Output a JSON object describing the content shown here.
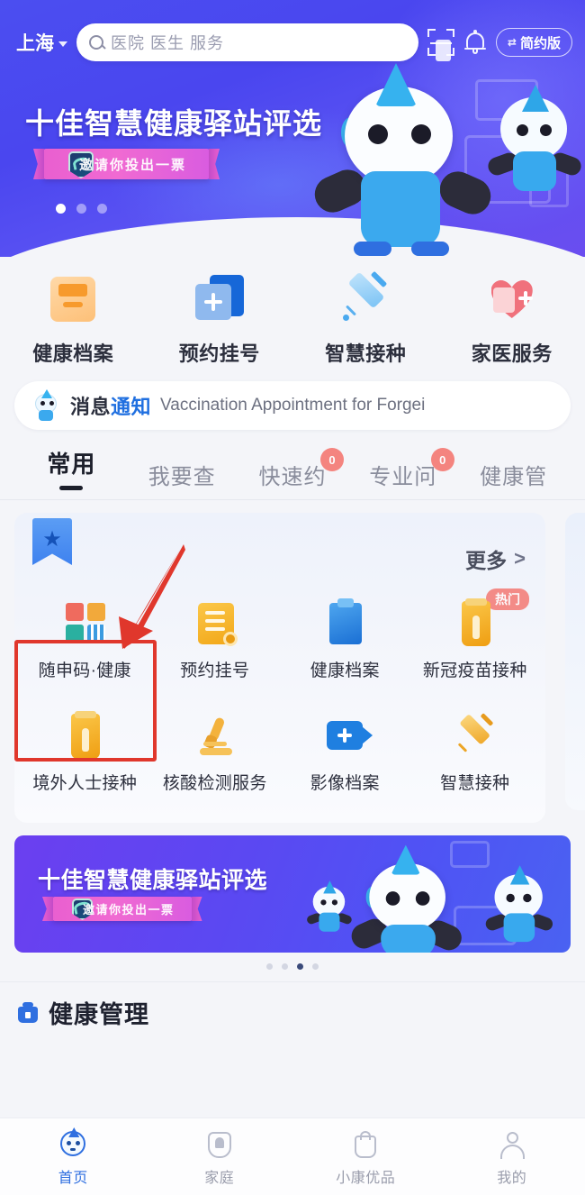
{
  "header": {
    "city": "上海",
    "city_chevron_icon": "chevron-down-icon",
    "search_placeholder": "医院 医生 服务",
    "search_icon": "search-icon",
    "scan_icon": "scan-code-icon",
    "bell_icon": "bell-icon",
    "simple_mode_label": "简约版",
    "simple_mode_icon": "toggle-icon"
  },
  "hero_banner": {
    "title": "十佳智慧健康驿站评选",
    "ribbon_text": "邀请你投出一票",
    "seal_icon": "shield-handshake-icon",
    "dots_total": 3,
    "dots_active": 1
  },
  "quick_actions": [
    {
      "label": "健康档案",
      "icon": "health-record-icon"
    },
    {
      "label": "预约挂号",
      "icon": "appointment-icon"
    },
    {
      "label": "智慧接种",
      "icon": "smart-vaccination-icon"
    },
    {
      "label": "家医服务",
      "icon": "family-doctor-icon"
    }
  ],
  "notice": {
    "mascot_icon": "mascot-icon",
    "title_part1": "消息",
    "title_part2": "通知",
    "text": "Vaccination Appointment for Forgei"
  },
  "tabs": [
    {
      "label": "常用",
      "active": true,
      "badge": ""
    },
    {
      "label": "我要查",
      "active": false,
      "badge": ""
    },
    {
      "label": "快速约",
      "active": false,
      "badge": "0"
    },
    {
      "label": "专业问",
      "active": false,
      "badge": "0"
    },
    {
      "label": "健康管",
      "active": false,
      "badge": ""
    }
  ],
  "favorites_card": {
    "bookmark_icon": "bookmark-star-icon",
    "star_glyph": "★",
    "more_label": "更多",
    "more_arrow": ">",
    "items": [
      {
        "label": "随申码·健康",
        "icon": "health-code-icon",
        "badge": "",
        "highlighted": true
      },
      {
        "label": "预约挂号",
        "icon": "appointment-form-icon",
        "badge": ""
      },
      {
        "label": "健康档案",
        "icon": "clipboard-icon",
        "badge": ""
      },
      {
        "label": "新冠疫苗接种",
        "icon": "covid-vaccine-icon",
        "badge": "热门"
      },
      {
        "label": "境外人士接种",
        "icon": "covid-vial-icon",
        "badge": ""
      },
      {
        "label": "核酸检测服务",
        "icon": "microscope-icon",
        "badge": ""
      },
      {
        "label": "影像档案",
        "icon": "imaging-camera-icon",
        "badge": ""
      },
      {
        "label": "智慧接种",
        "icon": "syringe-icon",
        "badge": ""
      }
    ]
  },
  "annotation": {
    "arrow_icon": "red-arrow-icon",
    "highlight_box_icon": "red-highlight-box",
    "color": "#e0372c"
  },
  "bottom_banner": {
    "title": "十佳智慧健康驿站评选",
    "ribbon_text": "邀请你投出一票",
    "seal_icon": "shield-handshake-icon",
    "dots_total": 4,
    "dots_active": 3
  },
  "section": {
    "icon": "health-management-icon",
    "title": "健康管理"
  },
  "tabbar": [
    {
      "label": "首页",
      "icon": "home-mascot-icon",
      "active": true
    },
    {
      "label": "家庭",
      "icon": "family-icon",
      "active": false
    },
    {
      "label": "小康优品",
      "icon": "shopping-bag-icon",
      "active": false
    },
    {
      "label": "我的",
      "icon": "person-icon",
      "active": false
    }
  ],
  "colors": {
    "hero_blue": "#4b4ef0",
    "accent_blue": "#2f6fe0",
    "badge_red": "#f4716a",
    "annotation_red": "#e0372c",
    "ribbon_pink": "#e95fd0"
  }
}
